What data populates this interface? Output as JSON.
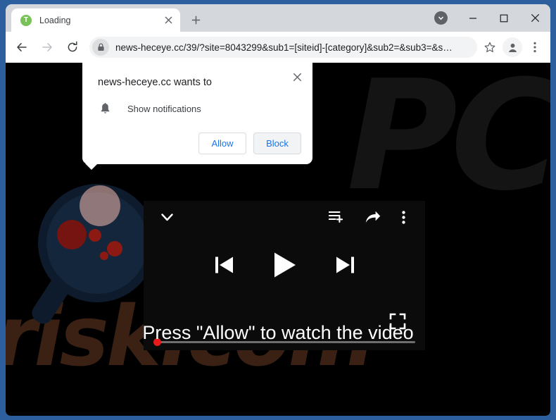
{
  "browser": {
    "tab": {
      "favicon_letter": "T",
      "favicon_color": "#78c257",
      "title": "Loading",
      "close_label": "×",
      "new_tab_label": "+"
    },
    "window_controls": {
      "minimize_label": "—",
      "maximize_label": "□",
      "close_label": "✕"
    },
    "toolbar": {
      "back_label": "←",
      "forward_label": "→",
      "reload_label": "↻",
      "url": "news-heceye.cc/39/?site=8043299&sub1=[siteid]-[category]&sub2=&sub3=&s…",
      "lock_icon": "lock-icon",
      "bookmark_icon": "star-icon",
      "profile_icon": "person-icon",
      "menu_icon": "three-dot-menu-icon"
    }
  },
  "permission_dialog": {
    "title": "news-heceye.cc wants to",
    "request_icon": "bell-icon",
    "request_label": "Show notifications",
    "allow_label": "Allow",
    "block_label": "Block",
    "close_label": "✕",
    "accent_color": "#1a73e8"
  },
  "page": {
    "background_color": "#000000",
    "watermark_top": "PC",
    "watermark_bottom": "risk.com",
    "cta_message": "Press \"Allow\" to watch the video",
    "player": {
      "collapse_icon": "chevron-down-icon",
      "add_to_queue_icon": "add-to-queue-icon",
      "share_icon": "share-icon",
      "more_icon": "three-dot-menu-icon",
      "previous_icon": "previous-track-icon",
      "play_icon": "play-icon",
      "next_icon": "next-track-icon",
      "fullscreen_icon": "fullscreen-icon",
      "progress_percent": 0,
      "progress_knob_color": "#e81b1b"
    }
  }
}
